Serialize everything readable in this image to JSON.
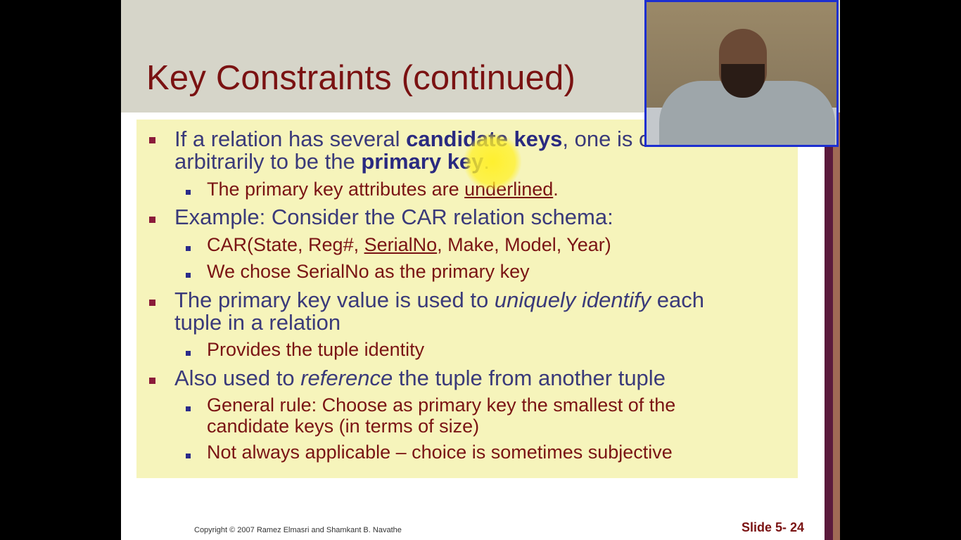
{
  "slide": {
    "title": "Key Constraints (continued)",
    "bullets": [
      {
        "line1_pre": "If a relation has several ",
        "line1_bold": "candidate keys",
        "line1_post": ", one is chosen",
        "line2_pre": "arbitrarily to be the ",
        "line2_bold": "primary key",
        "line2_post": ".",
        "sub": [
          {
            "pre": "The primary key attributes are ",
            "underline": "underlined",
            "post": "."
          }
        ]
      },
      {
        "text": "Example: Consider the CAR relation schema:",
        "sub": [
          {
            "pre": "CAR(State, Reg#, ",
            "underline": "SerialNo",
            "post": ", Make, Model, Year)"
          },
          {
            "text": "We chose SerialNo as the primary key"
          }
        ]
      },
      {
        "line1_pre": "The primary key value is used to ",
        "line1_italic": "uniquely identify",
        "line1_post": " each",
        "line2": "tuple in a relation",
        "sub": [
          {
            "text": "Provides the tuple identity"
          }
        ]
      },
      {
        "pre": "Also used to ",
        "italic": "reference",
        "post": " the tuple from another tuple",
        "sub": [
          {
            "line1": "General rule: Choose as primary key the smallest of the",
            "line2": "candidate keys (in terms of size)"
          },
          {
            "text": "Not always applicable – choice is sometimes subjective"
          }
        ]
      }
    ],
    "copyright": "Copyright © 2007 Ramez Elmasri and Shamkant B. Navathe",
    "slide_number": "Slide 5- 24"
  },
  "colors": {
    "title": "#7a1212",
    "level1_text": "#3a3a7a",
    "level2_text": "#7a1414",
    "content_bg": "#f6f4bb",
    "title_band": "#d6d5c9",
    "webcam_border": "#1d2fd0",
    "highlight": "#fff028"
  }
}
